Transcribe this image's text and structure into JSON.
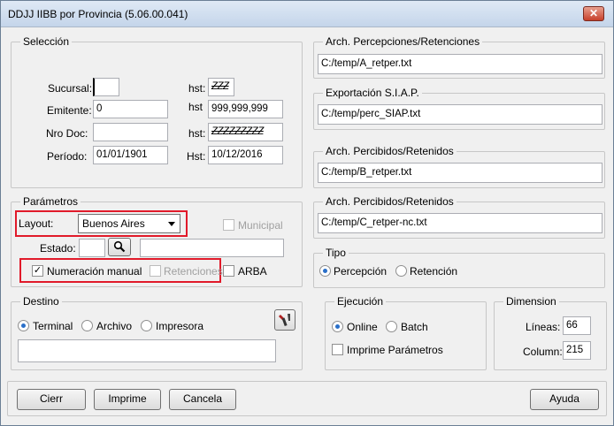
{
  "window": {
    "title": "DDJJ IIBB por Provincia (5.06.00.041)",
    "close_glyph": "✕"
  },
  "seleccion": {
    "title": "Selección",
    "sucursal_label": "Sucursal:",
    "sucursal_value": "",
    "sucursal_hst_label": "hst:",
    "sucursal_hst_value": "ZZZ",
    "emitente_label": "Emitente:",
    "emitente_value": "0",
    "emitente_hst_label": "hst",
    "emitente_hst_value": "999,999,999",
    "nrodoc_label": "Nro Doc:",
    "nrodoc_value": "",
    "nrodoc_hst_label": "hst:",
    "nrodoc_hst_value": "ZZZZZZZZZ",
    "periodo_label": "Período:",
    "periodo_value": "01/01/1901",
    "periodo_hst_label": "Hst:",
    "periodo_hst_value": "10/12/2016"
  },
  "parametros": {
    "title": "Parámetros",
    "layout_label": "Layout:",
    "layout_value": "Buenos Aires",
    "municipal_label": "Municipal",
    "estado_label": "Estado:",
    "estado_value": "",
    "estado_desc": "",
    "numeracion_label": "Numeración manual",
    "retenciones_label": "Retenciones",
    "arba_label": "ARBA"
  },
  "destino": {
    "title": "Destino",
    "terminal_label": "Terminal",
    "archivo_label": "Archivo",
    "impresora_label": "Impresora",
    "path_value": ""
  },
  "archivos": {
    "percepciones_title": "Arch. Percepciones/Retenciones",
    "percepciones_value": "C:/temp/A_retper.txt",
    "siap_title": "Exportación S.I.A.P.",
    "siap_value": "C:/temp/perc_SIAP.txt",
    "percibidos_title": "Arch. Percibidos/Retenidos",
    "percibidos_value": "C:/temp/B_retper.txt",
    "percibidos2_title": "Arch. Percibidos/Retenidos",
    "percibidos2_value": "C:/temp/C_retper-nc.txt"
  },
  "tipo": {
    "title": "Tipo",
    "percepcion_label": "Percepción",
    "retencion_label": "Retención"
  },
  "ejecucion": {
    "title": "Ejecución",
    "online_label": "Online",
    "batch_label": "Batch",
    "imprime_label": "Imprime Parámetros"
  },
  "dimension": {
    "title": "Dimension",
    "lineas_label": "Líneas:",
    "lineas_value": "66",
    "column_label": "Column:",
    "column_value": "215"
  },
  "buttons": {
    "cierr": "Cierr",
    "imprime": "Imprime",
    "cancela": "Cancela",
    "ayuda": "Ayuda"
  },
  "colors": {
    "accent_red": "#e11a2a",
    "radio_blue": "#2a6fc9"
  }
}
